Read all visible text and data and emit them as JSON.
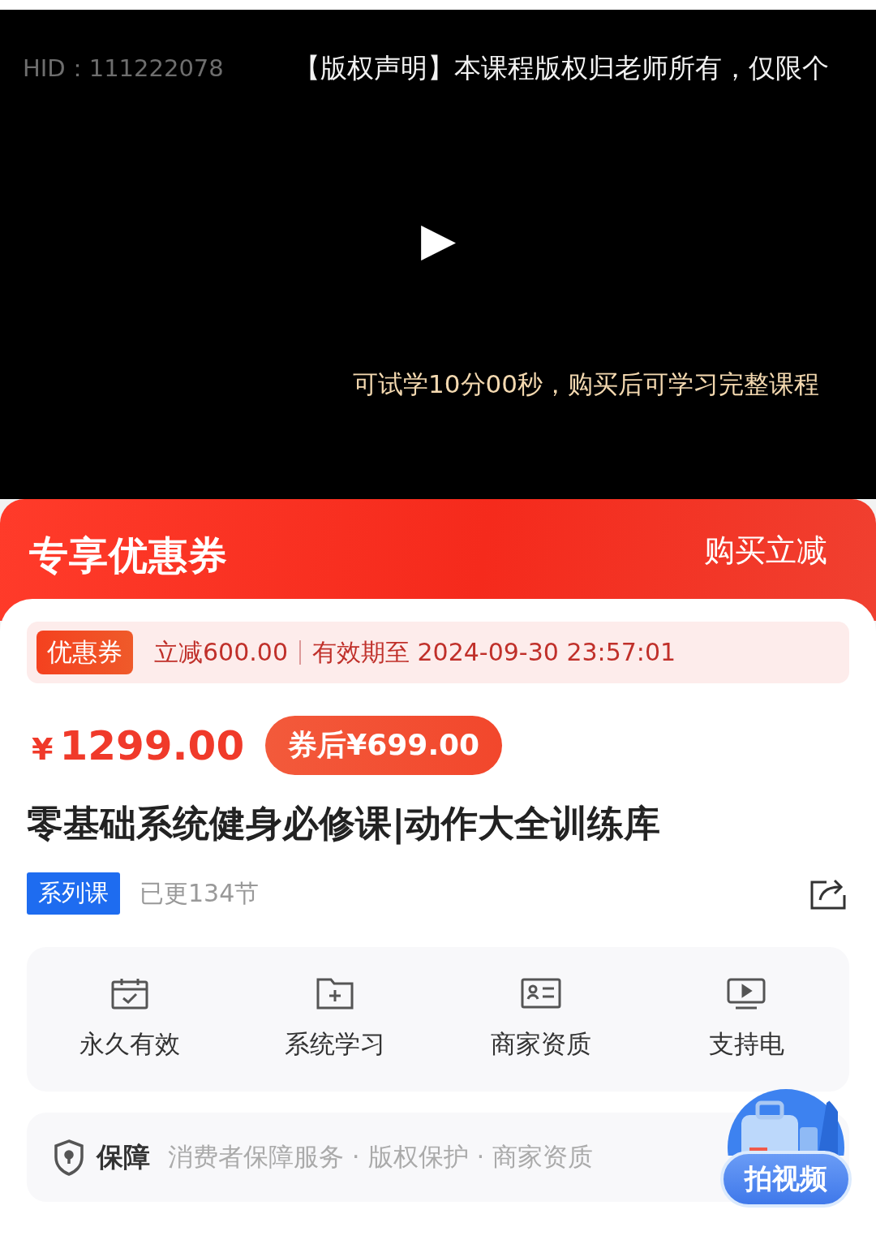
{
  "video": {
    "hid": "HID：111222078",
    "notice": "【版权声明】本课程版权归老师所有，仅限个",
    "play": "▶",
    "trial_note": "可试学10分00秒，购买后可学习完整课程"
  },
  "coupon_banner": {
    "title": "专享优惠券",
    "action": "购买立减"
  },
  "coupon": {
    "tag": "优惠券",
    "discount": "立减600.00",
    "validity": "有效期至 2024-09-30 23:57:01"
  },
  "price": {
    "currency": "¥",
    "amount": "1299.00",
    "after_coupon": "券后¥699.00"
  },
  "course": {
    "title": "零基础系统健身必修课|动作大全训练库",
    "tag": "系列课",
    "updates": "已更134节"
  },
  "features": [
    {
      "kind": "calendar",
      "label": "永久有效"
    },
    {
      "kind": "folder",
      "label": "系统学习"
    },
    {
      "kind": "card",
      "label": "商家资质"
    },
    {
      "kind": "screen",
      "label": "支持电"
    }
  ],
  "guarantee": {
    "label": "保障",
    "items": "消费者保障服务 · 版权保护 · 商家资质"
  },
  "float_button": {
    "label": "拍视频"
  }
}
